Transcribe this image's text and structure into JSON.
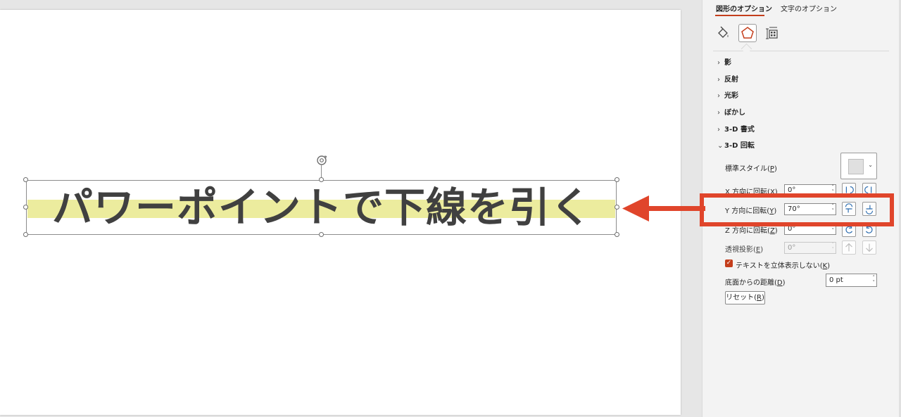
{
  "slide": {
    "text": "パワーポイントで下線を引く",
    "highlight_color": "#ecec9e",
    "text_color": "#404040"
  },
  "pane": {
    "tabs": [
      {
        "label": "図形のオプション",
        "active": true
      },
      {
        "label": "文字のオプション",
        "active": false
      }
    ],
    "icons": [
      "fill-line-icon",
      "effects-icon",
      "size-properties-icon"
    ],
    "sections": [
      {
        "label": "影",
        "expanded": false
      },
      {
        "label": "反射",
        "expanded": false
      },
      {
        "label": "光彩",
        "expanded": false
      },
      {
        "label": "ぼかし",
        "expanded": false
      },
      {
        "label": "3-D 書式",
        "expanded": false
      },
      {
        "label": "3-D 回転",
        "expanded": true
      }
    ],
    "rotation": {
      "preset_label": "標準スタイル(",
      "preset_key": "P",
      "x": {
        "label": "X 方向に回転(",
        "key": "X",
        "value": "0°"
      },
      "y": {
        "label": "Y 方向に回転(",
        "key": "Y",
        "value": "70°"
      },
      "z": {
        "label": "Z 方向に回転(",
        "key": "Z",
        "value": "0°"
      },
      "perspective": {
        "label": "透視投影(",
        "key": "E",
        "value": "0°"
      },
      "keep_flat": {
        "label": "テキストを立体表示しない(",
        "key": "K",
        "checked": true
      },
      "distance": {
        "label": "底面からの距離(",
        "key": "D",
        "value": "0 pt"
      },
      "reset_label": "リセット(",
      "reset_key": "R"
    },
    "accent_color": "#c43e1c"
  },
  "annotation": {
    "color": "#e0452b"
  }
}
